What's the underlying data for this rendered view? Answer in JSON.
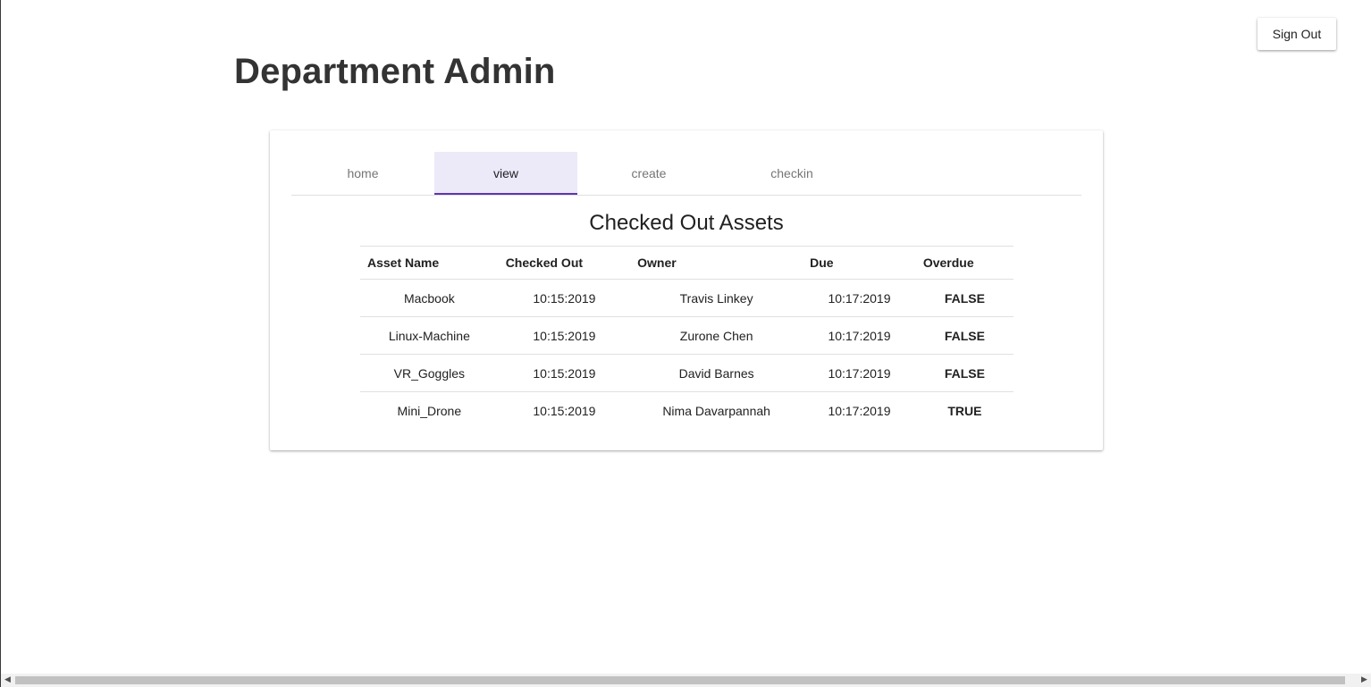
{
  "header": {
    "title": "Department Admin",
    "signout_label": "Sign Out"
  },
  "tabs": [
    {
      "label": "home",
      "active": false
    },
    {
      "label": "view",
      "active": true
    },
    {
      "label": "create",
      "active": false
    },
    {
      "label": "checkin",
      "active": false
    }
  ],
  "table": {
    "title": "Checked Out Assets",
    "columns": [
      "Asset Name",
      "Checked Out",
      "Owner",
      "Due",
      "Overdue"
    ],
    "rows": [
      {
        "asset": "Macbook",
        "checked_out": "10:15:2019",
        "owner": "Travis Linkey",
        "due": "10:17:2019",
        "overdue": "FALSE"
      },
      {
        "asset": "Linux-Machine",
        "checked_out": "10:15:2019",
        "owner": "Zurone Chen",
        "due": "10:17:2019",
        "overdue": "FALSE"
      },
      {
        "asset": "VR_Goggles",
        "checked_out": "10:15:2019",
        "owner": "David Barnes",
        "due": "10:17:2019",
        "overdue": "FALSE"
      },
      {
        "asset": "Mini_Drone",
        "checked_out": "10:15:2019",
        "owner": "Nima Davarpannah",
        "due": "10:17:2019",
        "overdue": "TRUE"
      }
    ]
  },
  "colors": {
    "accent": "#5e35b1",
    "active_tab_bg": "#ece9f9",
    "overdue_true": "#e00000",
    "overdue_false": "#7a7a7a"
  },
  "icons": {
    "scroll_left": "scroll-left-arrow-icon",
    "scroll_right": "scroll-right-arrow-icon"
  }
}
